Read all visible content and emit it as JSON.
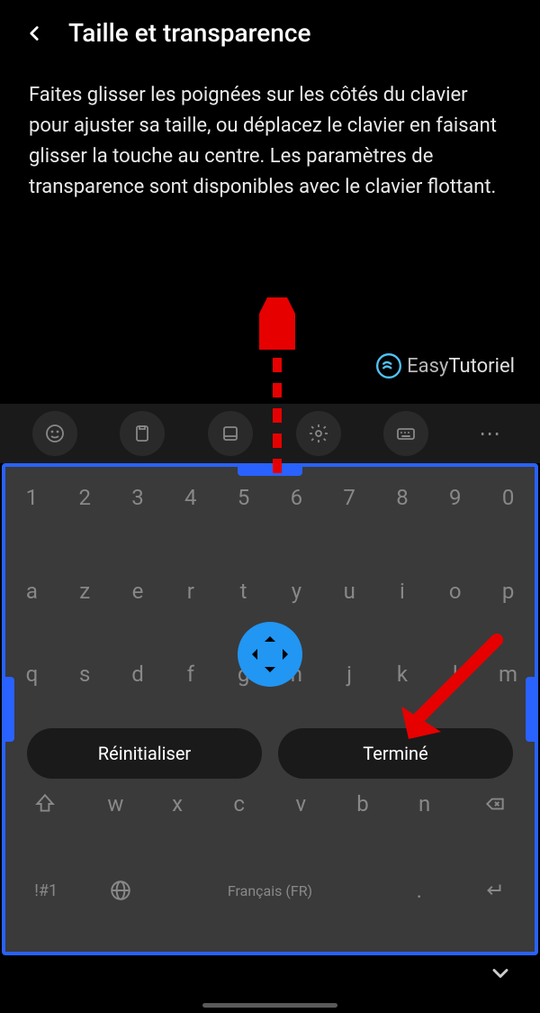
{
  "header": {
    "title": "Taille et transparence"
  },
  "description": "Faites glisser les poignées sur les côtés du clavier pour ajuster sa taille, ou déplacez le clavier en faisant glisser la touche au centre. Les paramètres de transparence sont disponibles avec le clavier flottant.",
  "watermark": {
    "prefix": "Easy",
    "suffix": "Tutoriel"
  },
  "keyboard": {
    "row_numbers": [
      "1",
      "2",
      "3",
      "4",
      "5",
      "6",
      "7",
      "8",
      "9",
      "0"
    ],
    "row1": [
      "a",
      "z",
      "e",
      "r",
      "t",
      "y",
      "u",
      "i",
      "o",
      "p"
    ],
    "row2": [
      "q",
      "s",
      "d",
      "f",
      "g",
      "h",
      "j",
      "k",
      "l",
      "m"
    ],
    "row3": [
      "w",
      "x",
      "c",
      "v",
      "b",
      "n"
    ],
    "symbol_key": "!#1",
    "space_label": "Français (FR)",
    "period": "."
  },
  "buttons": {
    "reset": "Réinitialiser",
    "done": "Terminé"
  }
}
